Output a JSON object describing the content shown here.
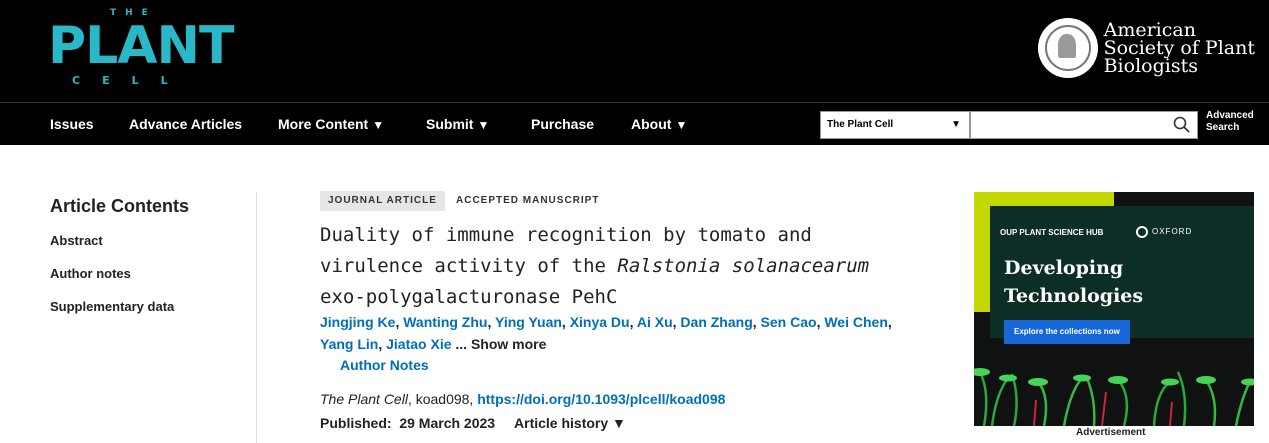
{
  "header": {
    "logo": {
      "the": "THE",
      "plant": "PLANT",
      "cell": "CELL"
    },
    "society": {
      "line1": "American",
      "line2": "Society of Plant",
      "line3": "Biologists"
    }
  },
  "nav": {
    "items": [
      {
        "label": "Issues"
      },
      {
        "label": "Advance Articles"
      },
      {
        "label": "More Content",
        "caret": "▼"
      },
      {
        "label": "Submit",
        "caret": "▼"
      },
      {
        "label": "Purchase"
      },
      {
        "label": "About",
        "caret": "▼"
      }
    ],
    "search": {
      "scope": "The Plant Cell",
      "value": ""
    },
    "advanced": {
      "line1": "Advanced",
      "line2": "Search"
    }
  },
  "sidebar": {
    "title": "Article Contents",
    "links": [
      "Abstract",
      "Author notes",
      "Supplementary data"
    ]
  },
  "article": {
    "badge_type": "JOURNAL ARTICLE",
    "badge_status": "ACCEPTED MANUSCRIPT",
    "title_part1": "Duality of immune recognition by tomato and virulence activity of the ",
    "title_italic": "Ralstonia solanacearum",
    "title_part2": " exo-polygalacturonase PehC",
    "authors": [
      "Jingjing Ke",
      "Wanting Zhu",
      "Ying Yuan",
      "Xinya Du",
      "Ai Xu",
      "Dan Zhang",
      "Sen Cao",
      "Wei Chen",
      "Yang Lin",
      "Jiatao Xie"
    ],
    "show_more": "... Show more",
    "author_notes": "Author Notes",
    "journal": "The Plant Cell",
    "article_id": ", koad098, ",
    "doi": "https://doi.org/10.1093/plcell/koad098",
    "published_label": "Published:",
    "published_date": "29 March 2023",
    "history": "Article history ▼"
  },
  "ad": {
    "hub": "OUP PLANT SCIENCE HUB",
    "oxford": "OXFORD",
    "headline1": "Developing",
    "headline2": "Technologies",
    "cta": "Explore the collections now",
    "label": "Advertisement"
  }
}
